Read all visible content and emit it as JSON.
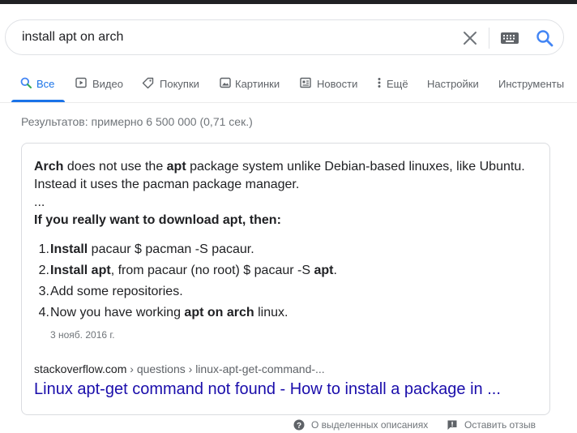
{
  "search": {
    "query": "install apt on arch",
    "icons": [
      "close-icon",
      "keyboard-icon",
      "search-icon"
    ]
  },
  "tabs": [
    {
      "label": "Все",
      "icon": "search-icon",
      "active": true
    },
    {
      "label": "Видео",
      "icon": "video-icon"
    },
    {
      "label": "Покупки",
      "icon": "tag-icon"
    },
    {
      "label": "Картинки",
      "icon": "image-icon"
    },
    {
      "label": "Новости",
      "icon": "news-icon"
    },
    {
      "label": "Ещё",
      "icon": "more-vert-icon"
    },
    {
      "label": "Настройки"
    },
    {
      "label": "Инструменты"
    }
  ],
  "stats": "Результатов: примерно 6 500 000 (0,71 сек.)",
  "snippet": {
    "p1_b1": "Arch",
    "p1_t1": " does not use the ",
    "p1_b2": "apt",
    "p1_t2": " package system unlike Debian-based linuxes, like Ubuntu. Instead it uses the pacman package manager.",
    "ellipsis": "...",
    "heading": "If you really want to download apt, then:",
    "steps": [
      {
        "num": "1.",
        "b1": "Install",
        "t1": " pacaur $ pacman -S pacaur."
      },
      {
        "num": "2.",
        "b1": "Install apt",
        "t1": ", from pacaur (no root) $ pacaur -S ",
        "b2": "apt",
        "t2": "."
      },
      {
        "num": "3.",
        "t1": "Add some repositories."
      },
      {
        "num": "4.",
        "t1": "Now you have working ",
        "b1": "apt on arch",
        "t2": " linux."
      }
    ],
    "date": "3 нояб. 2016 г.",
    "site": "stackoverflow.com",
    "path": " › questions › linux-apt-get-command-...",
    "link_title": "Linux apt-get command not found - How to install a package in ..."
  },
  "footer": {
    "about": "О выделенных описаниях",
    "feedback": "Оставить отзыв"
  },
  "colors": {
    "accent": "#1a73e8",
    "link": "#1a0dab",
    "text": "#202124",
    "muted": "#70757a",
    "border": "#dadce0"
  }
}
